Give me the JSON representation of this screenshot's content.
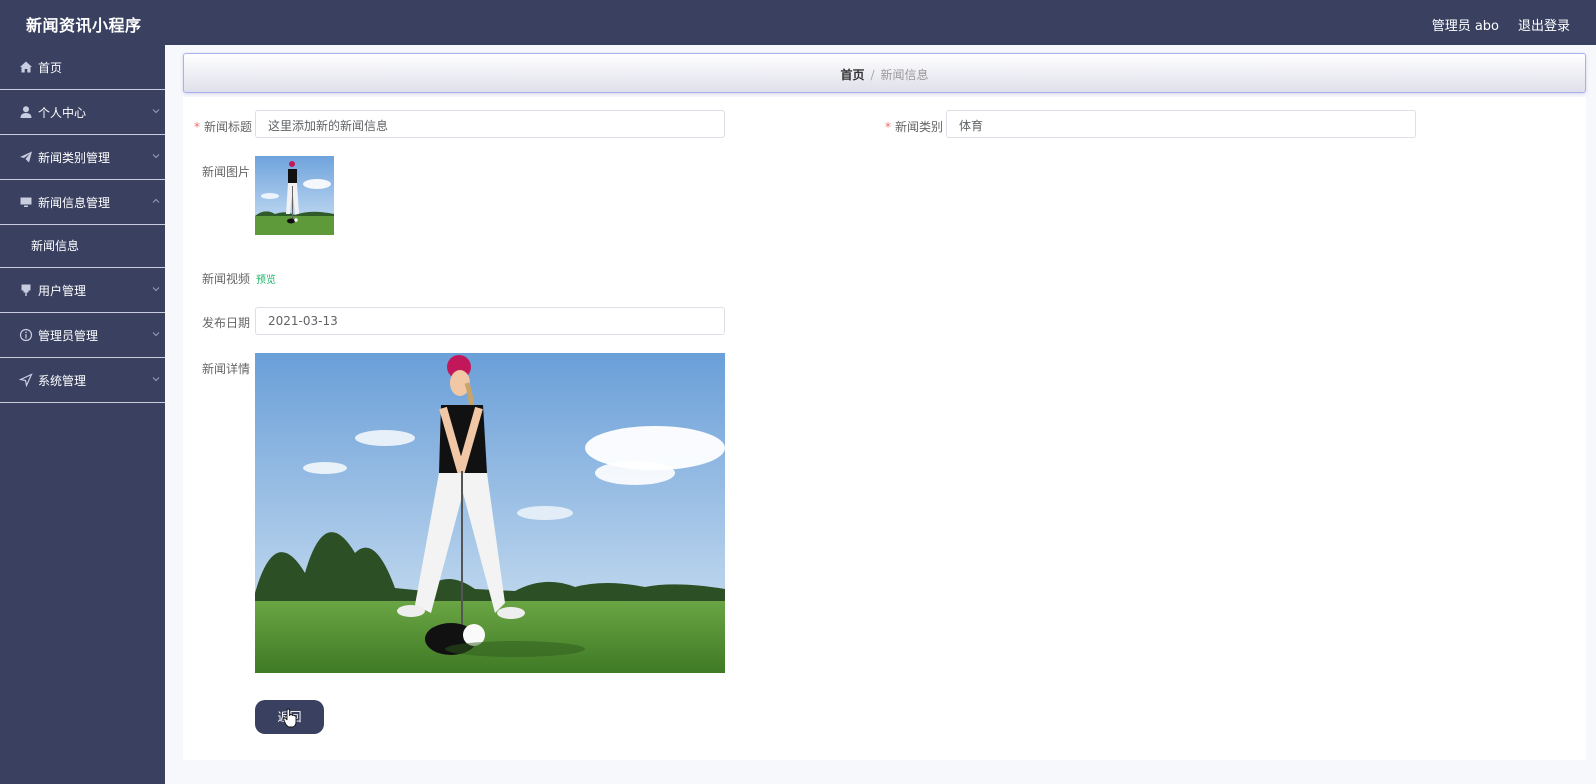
{
  "header": {
    "app_title": "新闻资讯小程序",
    "user_label": "管理员 abo",
    "logout_label": "退出登录"
  },
  "sidebar": {
    "items": [
      {
        "label": "首页",
        "icon": "home-icon"
      },
      {
        "label": "个人中心",
        "icon": "user-icon"
      },
      {
        "label": "新闻类别管理",
        "icon": "paper-plane-icon"
      },
      {
        "label": "新闻信息管理",
        "icon": "monitor-icon",
        "expanded": true,
        "children": [
          {
            "label": "新闻信息"
          }
        ]
      },
      {
        "label": "用户管理",
        "icon": "pin-icon"
      },
      {
        "label": "管理员管理",
        "icon": "info-icon"
      },
      {
        "label": "系统管理",
        "icon": "navigation-icon"
      }
    ]
  },
  "breadcrumb": {
    "home": "首页",
    "separator": "/",
    "current": "新闻信息"
  },
  "form": {
    "title_label": "新闻标题",
    "title_value": "这里添加新的新闻信息",
    "category_label": "新闻类别",
    "category_value": "体育",
    "image_label": "新闻图片",
    "video_label": "新闻视频",
    "video_preview": "预览",
    "date_label": "发布日期",
    "date_value": "2021-03-13",
    "detail_label": "新闻详情",
    "back_button": "返回",
    "required_mark": "*"
  },
  "colors": {
    "sidebar_bg": "#394060",
    "accent_border": "#aab0ee",
    "link_green": "#18b566",
    "required_red": "#f56c6c"
  }
}
